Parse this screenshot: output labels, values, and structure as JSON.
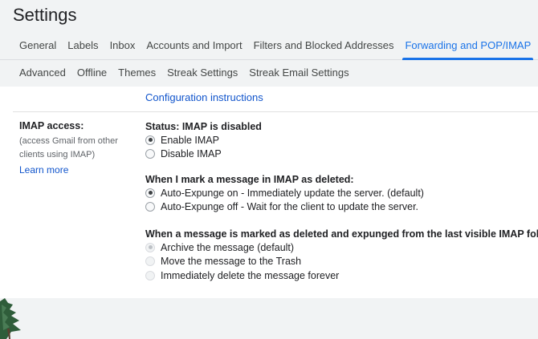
{
  "header": {
    "title": "Settings"
  },
  "tabs_row1": [
    {
      "label": "General",
      "active": false
    },
    {
      "label": "Labels",
      "active": false
    },
    {
      "label": "Inbox",
      "active": false
    },
    {
      "label": "Accounts and Import",
      "active": false
    },
    {
      "label": "Filters and Blocked Addresses",
      "active": false
    },
    {
      "label": "Forwarding and POP/IMAP",
      "active": true
    }
  ],
  "tabs_row2": [
    {
      "label": "Advanced"
    },
    {
      "label": "Offline"
    },
    {
      "label": "Themes"
    },
    {
      "label": "Streak Settings"
    },
    {
      "label": "Streak Email Settings"
    }
  ],
  "top_section": {
    "config_link": "Configuration instructions"
  },
  "imap": {
    "title": "IMAP access:",
    "description": "(access Gmail from other clients using IMAP)",
    "learn_more": "Learn more",
    "status": "Status: IMAP is disabled",
    "access_options": [
      {
        "label": "Enable IMAP",
        "checked": true
      },
      {
        "label": "Disable IMAP",
        "checked": false
      }
    ],
    "deleted_title": "When I mark a message in IMAP as deleted:",
    "deleted_options": [
      {
        "label": "Auto-Expunge on - Immediately update the server. (default)",
        "checked": true
      },
      {
        "label": "Auto-Expunge off - Wait for the client to update the server.",
        "checked": false
      }
    ],
    "expunged_title": "When a message is marked as deleted and expunged from the last visible IMAP folder:",
    "expunged_options": [
      {
        "label": "Archive the message (default)",
        "checked": true,
        "disabled": true
      },
      {
        "label": "Move the message to the Trash",
        "checked": false,
        "disabled": true
      },
      {
        "label": "Immediately delete the message forever",
        "checked": false,
        "disabled": true
      }
    ]
  },
  "colors": {
    "accent": "#1a73e8",
    "link": "#1155cc",
    "page_bg": "#f1f3f4"
  }
}
